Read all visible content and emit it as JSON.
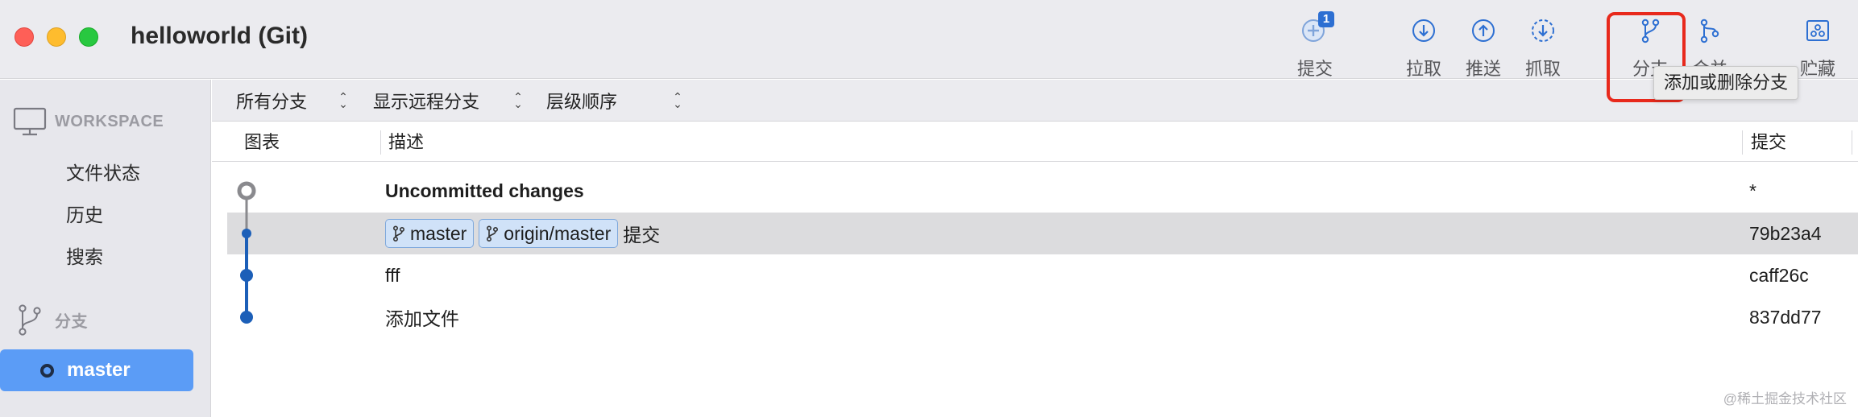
{
  "window": {
    "title": "helloworld (Git)"
  },
  "toolbar": {
    "commit_label": "提交",
    "commit_badge": "1",
    "pull_label": "拉取",
    "push_label": "推送",
    "fetch_label": "抓取",
    "branch_label": "分支",
    "merge_label": "合并",
    "stash_label": "贮藏",
    "tooltip": "添加或删除分支",
    "icon_color": "#2d6fd2",
    "highlight_color": "#e8291c"
  },
  "sidebar": {
    "workspace_header": "WORKSPACE",
    "workspace_items": [
      "文件状态",
      "历史",
      "搜索"
    ],
    "branches_header": "分支",
    "current_branch": "master",
    "selected_color": "#5b9cf6"
  },
  "filters": {
    "branches": "所有分支",
    "remote": "显示远程分支",
    "order": "层级顺序"
  },
  "table": {
    "columns": {
      "graph": "图表",
      "description": "描述",
      "commit": "提交"
    },
    "rows": [
      {
        "description": "Uncommitted changes",
        "commit": "*",
        "bold": true,
        "tags": []
      },
      {
        "description": "提交",
        "commit": "79b23a4",
        "selected": true,
        "tags": [
          "master",
          "origin/master"
        ]
      },
      {
        "description": "fff",
        "commit": "caff26c",
        "tags": []
      },
      {
        "description": "添加文件",
        "commit": "837dd77",
        "tags": []
      }
    ]
  },
  "watermark": "@稀土掘金技术社区"
}
